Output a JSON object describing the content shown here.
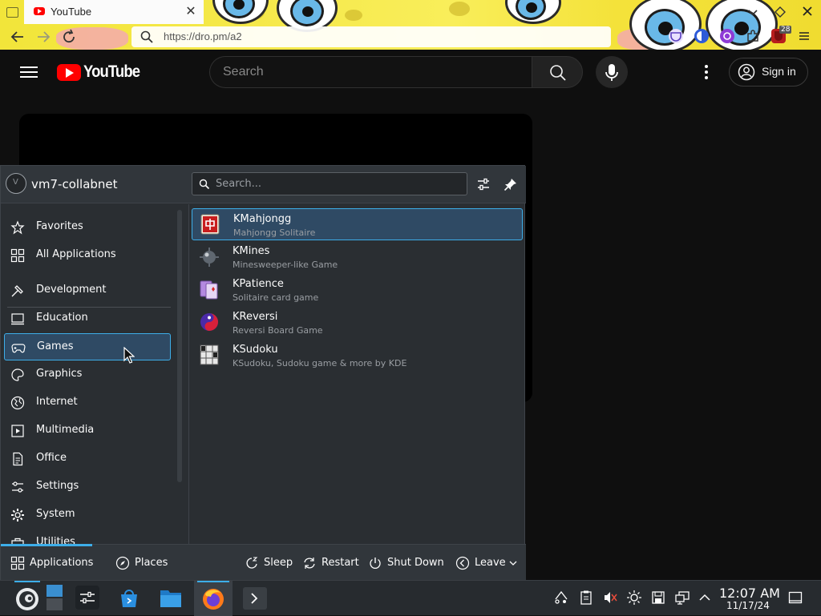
{
  "browser": {
    "tab_title": "YouTube",
    "close_glyph": "✕",
    "url": "https://dro.pm/a2",
    "extension_badge": "28",
    "icons": [
      "tab-overview-icon",
      "back-icon",
      "forward-icon",
      "reload-icon",
      "search-icon",
      "pocket-icon",
      "dark-reader-icon",
      "ublock-icon",
      "extensions-icon",
      "menu-icon"
    ]
  },
  "youtube": {
    "logo_text": "YouTube",
    "search_placeholder": "Search",
    "signin_label": "Sign in",
    "colors": {
      "brand": "#ff0000",
      "background": "#0f0f0f"
    }
  },
  "launcher": {
    "user_name": "vm7-collabnet",
    "search_placeholder": "Search...",
    "categories": [
      {
        "label": "Favorites",
        "icon": "star-icon"
      },
      {
        "label": "All Applications",
        "icon": "grid-icon"
      },
      {
        "label": "Development",
        "icon": "hammer-icon"
      },
      {
        "label": "Education",
        "icon": "laptop-icon"
      },
      {
        "label": "Games",
        "icon": "gamepad-icon",
        "selected": true
      },
      {
        "label": "Graphics",
        "icon": "palette-icon"
      },
      {
        "label": "Internet",
        "icon": "globe-icon"
      },
      {
        "label": "Multimedia",
        "icon": "media-icon"
      },
      {
        "label": "Office",
        "icon": "document-icon"
      },
      {
        "label": "Settings",
        "icon": "sliders-icon"
      },
      {
        "label": "System",
        "icon": "gear-icon"
      },
      {
        "label": "Utilities",
        "icon": "toolbox-icon"
      }
    ],
    "apps": [
      {
        "name": "KMahjongg",
        "description": "Mahjongg Solitaire",
        "selected": true
      },
      {
        "name": "KMines",
        "description": "Minesweeper-like Game"
      },
      {
        "name": "KPatience",
        "description": "Solitaire card game"
      },
      {
        "name": "KReversi",
        "description": "Reversi Board Game"
      },
      {
        "name": "KSudoku",
        "description": "KSudoku, Sudoku game & more by KDE"
      }
    ],
    "footer": {
      "applications": "Applications",
      "places": "Places",
      "sleep": "Sleep",
      "restart": "Restart",
      "shutdown": "Shut Down",
      "leave": "Leave"
    },
    "accent_color": "#3daee9"
  },
  "taskbar": {
    "time": "12:07 AM",
    "date": "11/17/24"
  }
}
